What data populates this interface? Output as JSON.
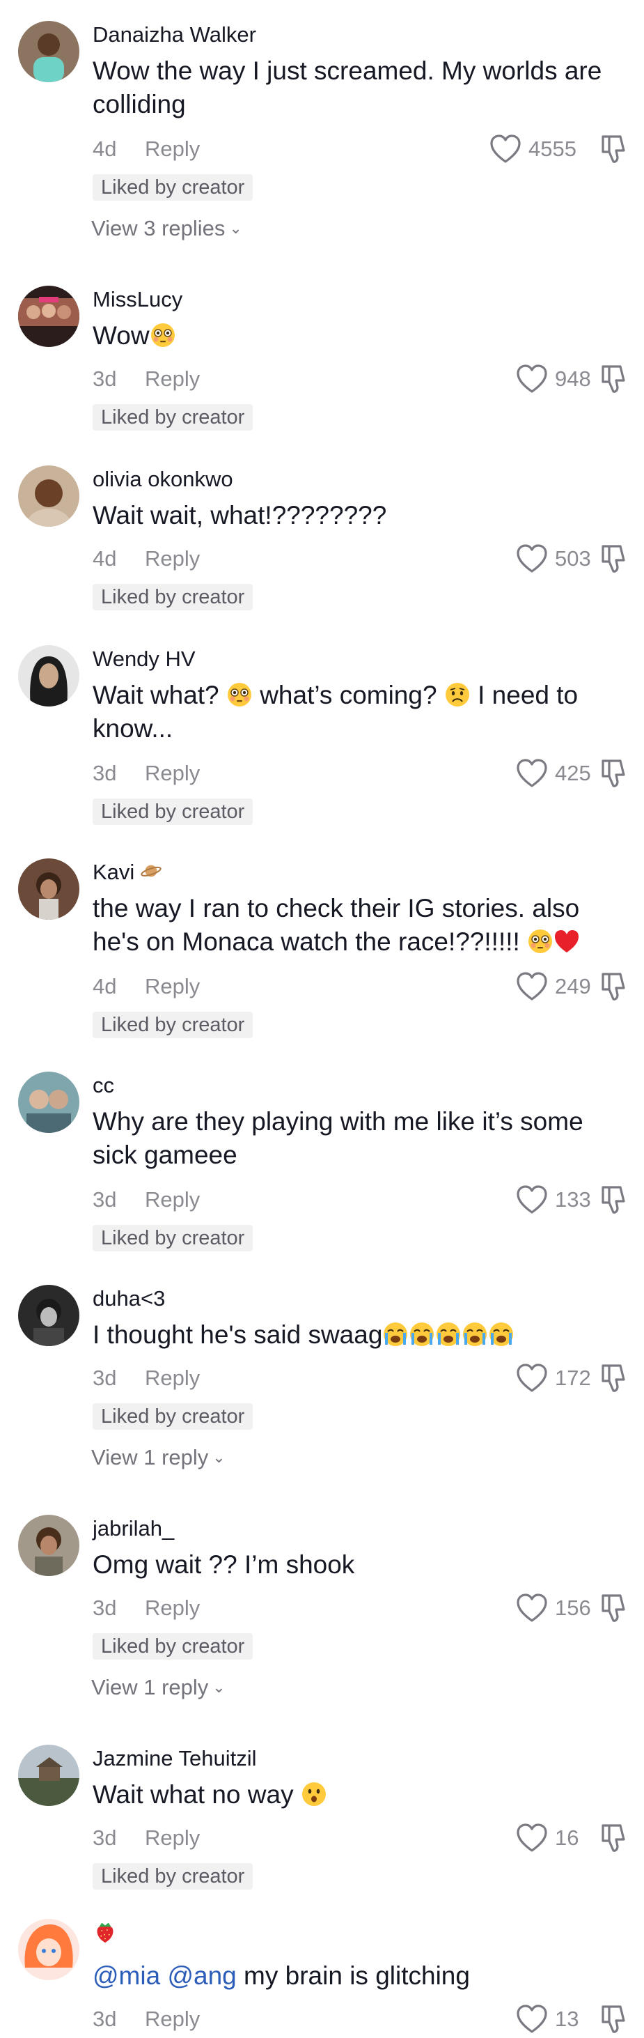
{
  "colors": {
    "text": "#161823",
    "muted": "#8a8b91",
    "mention": "#2b5db9",
    "badge_bg": "#f1f1f2"
  },
  "icons": {
    "like": "heart-outline-icon",
    "dislike": "thumbs-down-icon",
    "expand": "chevron-down-icon"
  },
  "comments": [
    {
      "username": "Danaizha Walker",
      "text": "Wow the way I just screamed. My worlds are colliding",
      "time": "4d",
      "reply_label": "Reply",
      "likes": "4555",
      "liked_by_creator": "Liked by creator",
      "view_replies": "View 3 replies"
    },
    {
      "username": "MissLucy",
      "text": "Wow",
      "time": "3d",
      "reply_label": "Reply",
      "likes": "948",
      "liked_by_creator": "Liked by creator"
    },
    {
      "username": "olivia okonkwo",
      "text": "Wait wait, what!????????",
      "time": "4d",
      "reply_label": "Reply",
      "likes": "503",
      "liked_by_creator": "Liked by creator"
    },
    {
      "username": "Wendy HV",
      "text_parts": [
        "Wait what? ",
        " what’s coming? ",
        " I need to know..."
      ],
      "time": "3d",
      "reply_label": "Reply",
      "likes": "425",
      "liked_by_creator": "Liked by creator"
    },
    {
      "username": "Kavi",
      "text": "the way I ran to check their IG stories. also he's on Monaca watch the race!??!!!!! ",
      "time": "4d",
      "reply_label": "Reply",
      "likes": "249",
      "liked_by_creator": "Liked by creator"
    },
    {
      "username": "cc",
      "text": "Why are they playing with me like it’s some sick gameee",
      "time": "3d",
      "reply_label": "Reply",
      "likes": "133",
      "liked_by_creator": "Liked by creator"
    },
    {
      "username": "duha<3",
      "text": "I thought he's said swaag",
      "time": "3d",
      "reply_label": "Reply",
      "likes": "172",
      "liked_by_creator": "Liked by creator",
      "view_replies": "View 1 reply"
    },
    {
      "username": "jabrilah_",
      "text": "Omg wait ?? I’m shook",
      "time": "3d",
      "reply_label": "Reply",
      "likes": "156",
      "liked_by_creator": "Liked by creator",
      "view_replies": "View 1 reply"
    },
    {
      "username": "Jazmine Tehuitzil",
      "text": "Wait what no way ",
      "time": "3d",
      "reply_label": "Reply",
      "likes": "16",
      "liked_by_creator": "Liked by creator"
    },
    {
      "username": "",
      "mentions": [
        "@mia",
        "@ang"
      ],
      "text": " my brain is glitching",
      "time": "3d",
      "reply_label": "Reply",
      "likes": "13"
    }
  ]
}
